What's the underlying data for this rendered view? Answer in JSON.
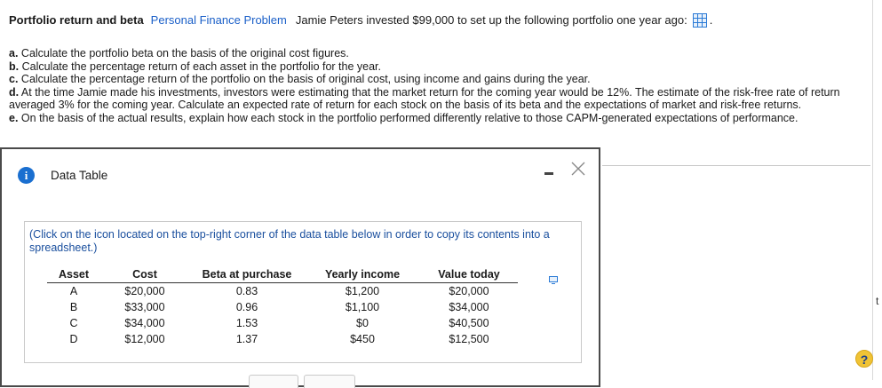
{
  "header": {
    "title": "Portfolio return and beta",
    "link": "Personal Finance Problem",
    "text": "Jamie Peters invested $99,000 to set up the following portfolio one year ago:",
    "period": "."
  },
  "questions": [
    {
      "letter": "a.",
      "text": "Calculate the portfolio beta on the basis of the original cost figures."
    },
    {
      "letter": "b.",
      "text": "Calculate the percentage return of each asset in the portfolio for the year."
    },
    {
      "letter": "c.",
      "text": "Calculate the percentage return of the portfolio on the basis of original cost, using income and gains during the year."
    },
    {
      "letter": "d.",
      "text": "At the time Jamie made his investments, investors were estimating that the market return for the coming year would be 12%.  The estimate of the risk-free rate of return averaged 3% for the coming year.  Calculate an expected rate of return for each stock on the basis of its beta and the expectations of market and risk-free returns."
    },
    {
      "letter": "e.",
      "text": "On the basis of the actual results, explain how each stock in the portfolio performed differently relative to those CAPM-generated expectations of performance."
    }
  ],
  "dialog": {
    "title": "Data Table",
    "note": "(Click on the icon located on the top-right corner of the data table below in order to copy its contents into a spreadsheet.)",
    "table": {
      "headers": [
        "Asset",
        "Cost",
        "Beta at purchase",
        "Yearly income",
        "Value today"
      ],
      "rows": [
        [
          "A",
          "$20,000",
          "0.83",
          "$1,200",
          "$20,000"
        ],
        [
          "B",
          "$33,000",
          "0.96",
          "$1,100",
          "$34,000"
        ],
        [
          "C",
          "$34,000",
          "1.53",
          "$0",
          "$40,500"
        ],
        [
          "D",
          "$12,000",
          "1.37",
          "$450",
          "$12,500"
        ]
      ]
    }
  },
  "help": {
    "label": "?"
  },
  "edge": {
    "char": "t"
  },
  "colors": {
    "link": "#1a5fc8",
    "info": "#1a6fd0",
    "help": "#f0c335"
  }
}
